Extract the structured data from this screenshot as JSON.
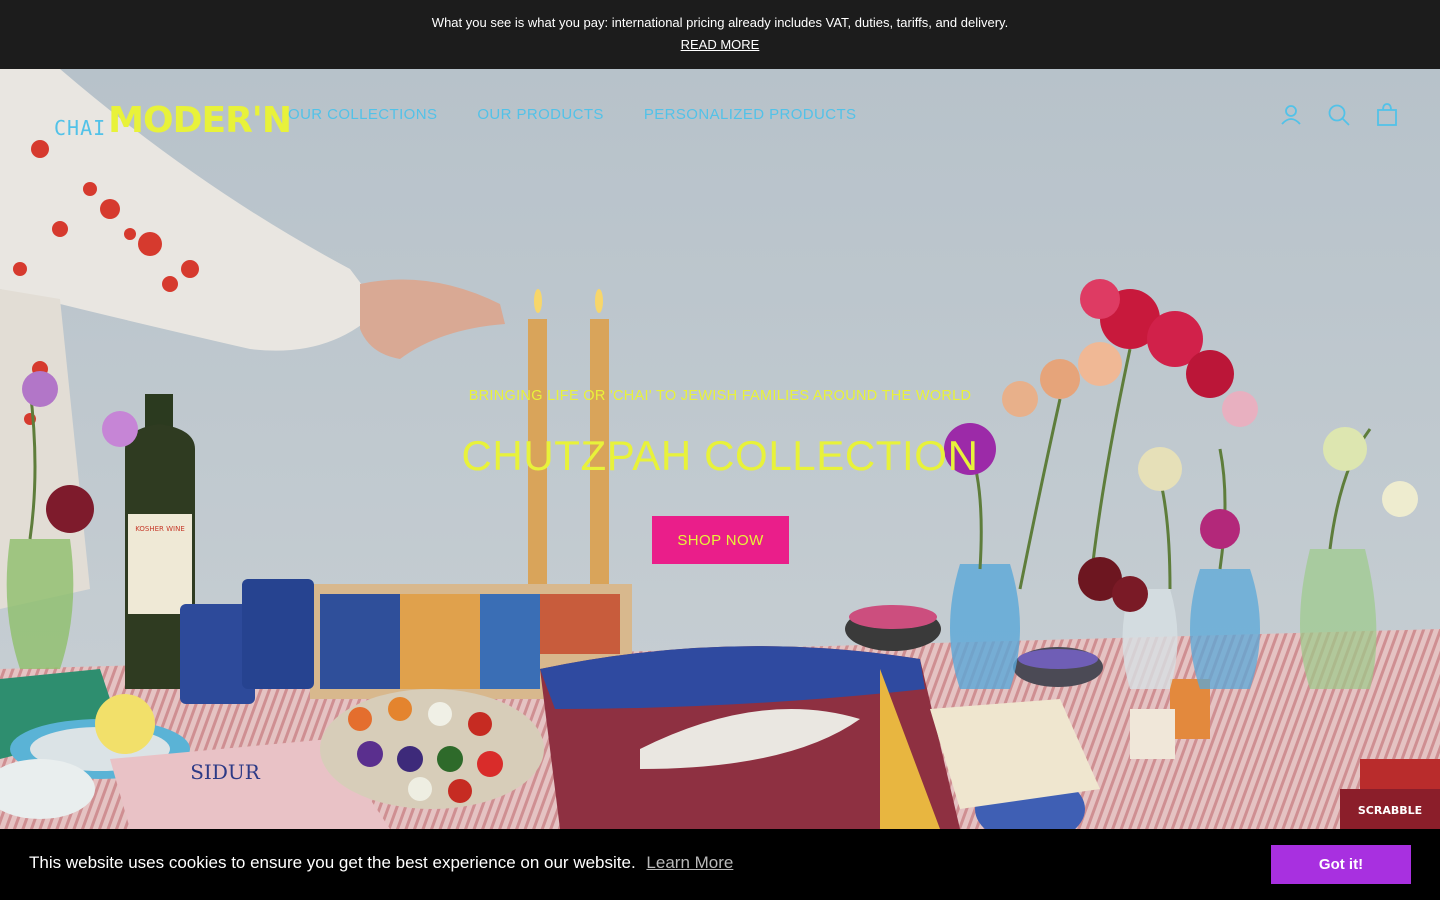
{
  "announcement": {
    "text": "What you see is what you pay: international pricing already includes VAT, duties, tariffs, and delivery.",
    "link_label": "READ MORE"
  },
  "header": {
    "logo_small": "CHAI",
    "logo_big": "MODER'N",
    "nav": [
      "OUR COLLECTIONS",
      "OUR PRODUCTS",
      "PERSONALIZED PRODUCTS"
    ],
    "icons": [
      "account-icon",
      "search-icon",
      "cart-icon"
    ]
  },
  "hero": {
    "subtitle": "BRINGING LIFE OR 'CHAI' TO JEWISH FAMILIES AROUND THE WORLD",
    "title": "CHUTZPAH COLLECTION",
    "button_label": "SHOP NOW",
    "image_text": {
      "wine_label": "KOSHER WINE",
      "book_title": "SIDUR",
      "game_box": "SCRABBLE"
    }
  },
  "cookie": {
    "text": "This website uses cookies to ensure you get the best experience on our website.",
    "learn_more": "Learn More",
    "accept_label": "Got it!"
  },
  "colors": {
    "accent_yellow": "#e8f23a",
    "nav_blue": "#52c2e8",
    "button_pink": "#ea1e8a",
    "cookie_purple": "#a830e0"
  }
}
